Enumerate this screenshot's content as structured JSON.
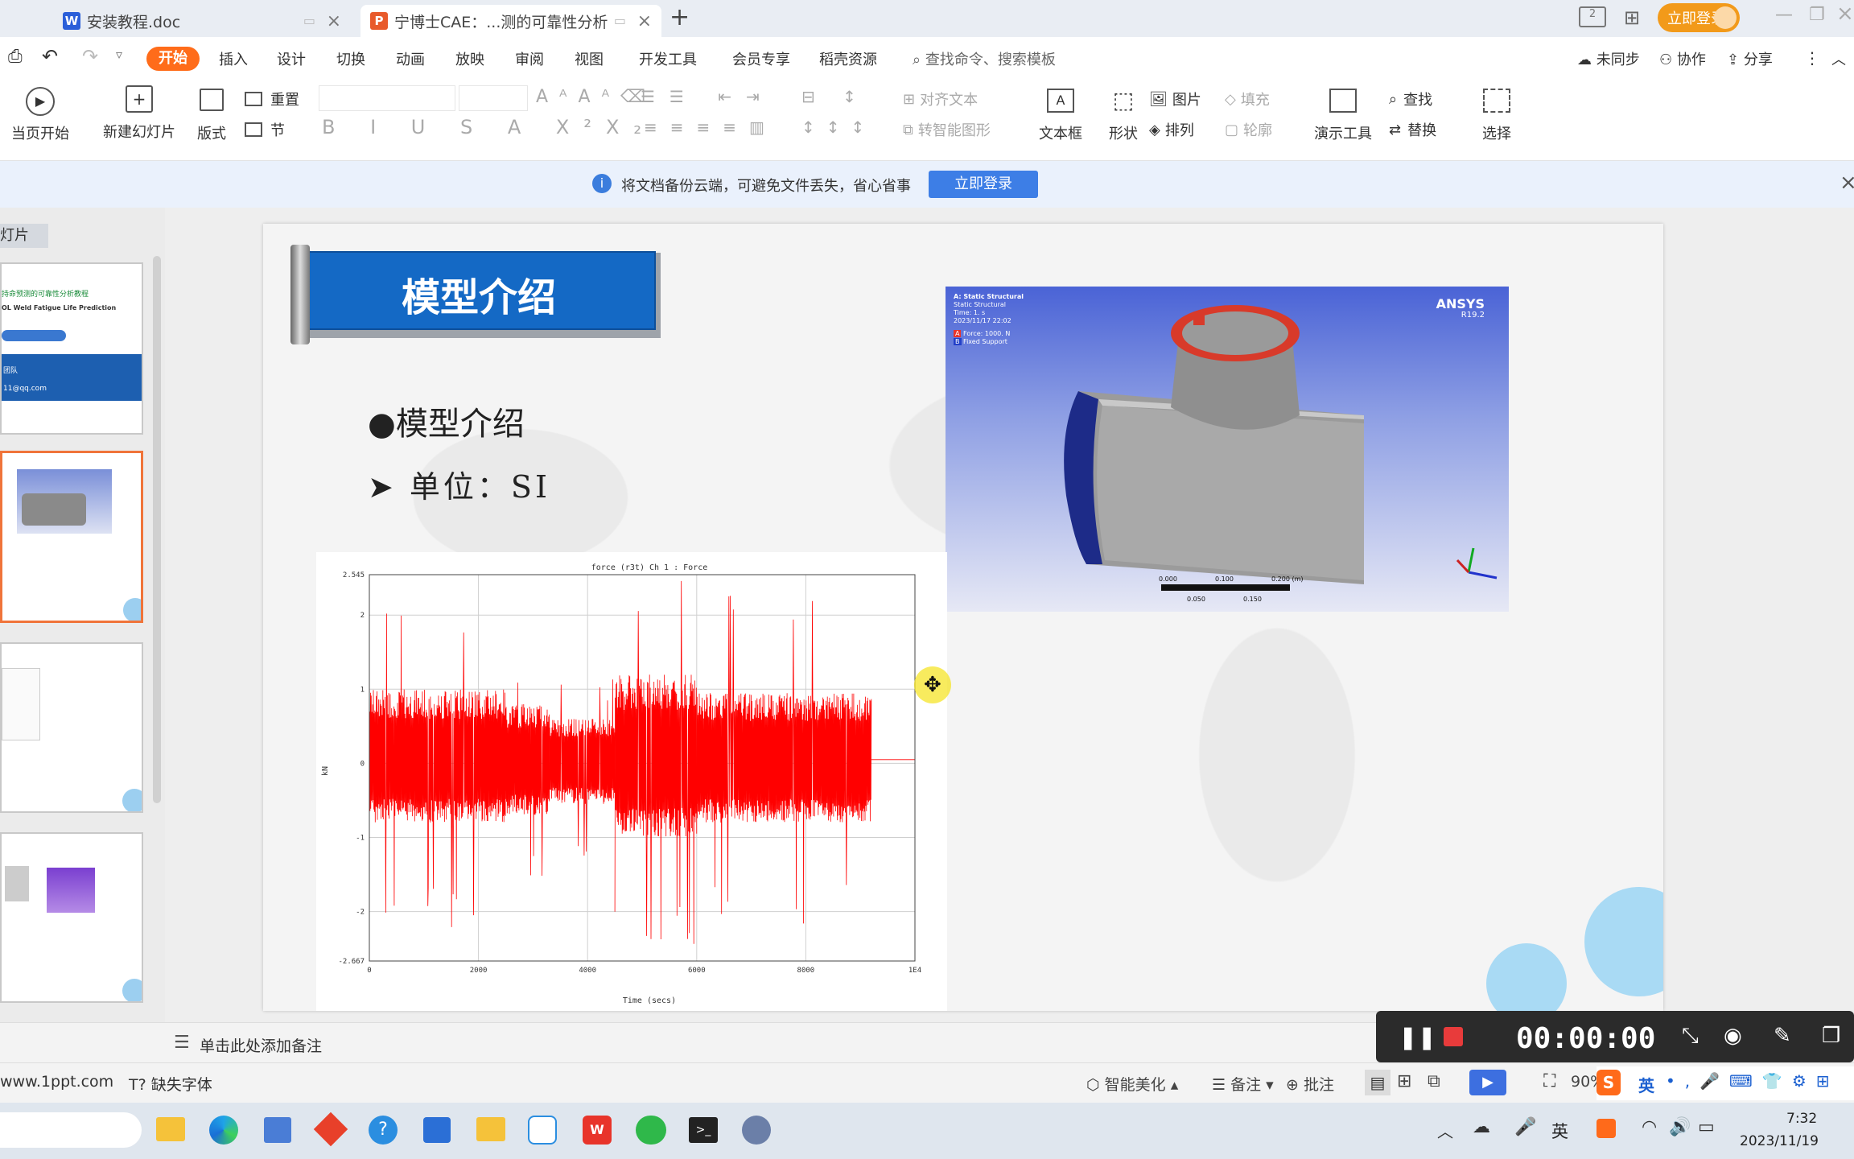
{
  "tabs": [
    {
      "label": "安装教程.doc",
      "icon": "W",
      "color": "#2b5fd9"
    },
    {
      "label": "宁博士CAE：...测的可靠性分析",
      "icon": "P",
      "color": "#e85a2b"
    }
  ],
  "titlebar": {
    "login_button": "立即登录"
  },
  "menu": {
    "start_label": "开始",
    "items": [
      "插入",
      "设计",
      "切换",
      "动画",
      "放映",
      "审阅",
      "视图",
      "开发工具",
      "会员专享",
      "稻壳资源"
    ],
    "search_placeholder": "查找命令、搜索模板",
    "sync": "未同步",
    "collab": "协作",
    "share": "分享"
  },
  "ribbon": {
    "play_from_current": "当页开始",
    "new_slide": "新建幻灯片",
    "layout": "版式",
    "reset": "重置",
    "section": "节",
    "align_text": "对齐文本",
    "smart_graphic": "转智能图形",
    "textbox": "文本框",
    "shape": "形状",
    "picture": "图片",
    "arrange": "排列",
    "fill": "填充",
    "outline": "轮廓",
    "presenter_tools": "演示工具",
    "find": "查找",
    "replace": "替换",
    "select": "选择"
  },
  "notice": {
    "text": "将文档备份云端，可避免文件丢失，省心省事",
    "button": "立即登录"
  },
  "thumbs": {
    "header": "幻灯片",
    "thumb1_line1": "持命预测的可靠性分析教程",
    "thumb1_line2": "OL Weld Fatigue Life Prediction",
    "thumb1_line3": "团队",
    "thumb1_line4": "11@qq.com"
  },
  "slide": {
    "title": "模型介绍",
    "bullet1": "●模型介绍",
    "bullet2": "➤ 单位：SI",
    "ansys_label": "ANSYS",
    "ansys_version": "R19.2",
    "ansys_info": [
      "A: Static Structural",
      "Static Structural",
      "Time: 1. s",
      "2023/11/17 22:02"
    ],
    "ansys_legend": [
      {
        "key": "A",
        "text": "Force: 1000. N",
        "color": "#e8342a"
      },
      {
        "key": "B",
        "text": "Fixed Support",
        "color": "#2340c8"
      }
    ],
    "ansys_scale": [
      "0.000",
      "0.100",
      "0.200 (m)",
      "0.050",
      "0.150"
    ]
  },
  "chart_data": {
    "type": "line",
    "title": "force (r3t)  Ch 1 : Force",
    "xlabel": "Time (secs)",
    "ylabel": "kN",
    "xlim": [
      0,
      10000
    ],
    "ylim": [
      -2.667,
      2.545
    ],
    "x_ticks": [
      "0",
      "2000",
      "4000",
      "6000",
      "8000",
      "1E4"
    ],
    "y_ticks": [
      "2.545",
      "2",
      "1",
      "0",
      "-1",
      "-2",
      "-2.667"
    ],
    "series": [
      {
        "color": "#ff0000",
        "segments": [
          {
            "x": [
              0,
              2500
            ],
            "envelope": [
              -0.8,
              1.0
            ],
            "peaks": [
              2.1,
              -2.3
            ]
          },
          {
            "x": [
              2500,
              3300
            ],
            "envelope": [
              -0.7,
              0.8
            ],
            "peaks": [
              1.3,
              -1.6
            ]
          },
          {
            "x": [
              3300,
              4500
            ],
            "envelope": [
              -0.55,
              0.6
            ],
            "peaks": [
              1.2,
              -1.5
            ]
          },
          {
            "x": [
              4500,
              6000
            ],
            "envelope": [
              -1.0,
              1.2
            ],
            "peaks": [
              2.5,
              -2.6
            ]
          },
          {
            "x": [
              6000,
              9200
            ],
            "envelope": [
              -0.8,
              0.95
            ],
            "peaks": [
              2.4,
              -2.2
            ]
          },
          {
            "x": [
              9200,
              10000
            ],
            "envelope": [
              0.05,
              0.05
            ],
            "peaks": [
              0.05,
              0.05
            ]
          }
        ]
      }
    ],
    "grid": true
  },
  "notes": {
    "placeholder": "单击此处添加备注"
  },
  "status": {
    "site": "www.1ppt.com",
    "missing_font": "缺失字体",
    "beautify": "智能美化",
    "notes": "备注",
    "comment": "批注",
    "zoom": "90%"
  },
  "recorder": {
    "time": "00:00:00"
  },
  "ime": {
    "lang": "英"
  },
  "taskbar": {
    "lang": "英",
    "time": "7:32",
    "date": "2023/11/19"
  }
}
